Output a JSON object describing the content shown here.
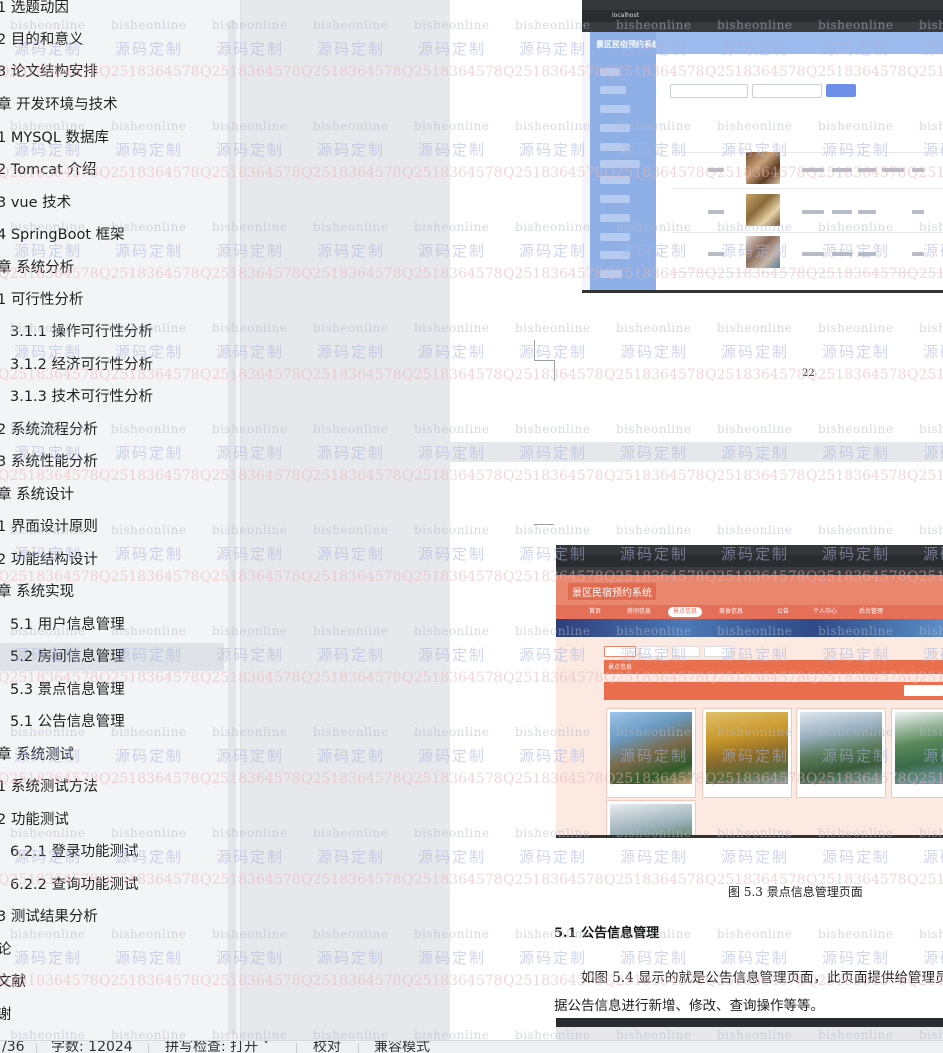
{
  "outline": {
    "items": [
      {
        "label": "1 选题动因",
        "level": 2
      },
      {
        "label": "2 目的和意义",
        "level": 2
      },
      {
        "label": "3 论文结构安排",
        "level": 2
      },
      {
        "label": "章  开发环境与技术",
        "level": 1
      },
      {
        "label": "1 MYSQL 数据库",
        "level": 2
      },
      {
        "label": "2 Tomcat  介绍",
        "level": 2
      },
      {
        "label": "3 vue 技术",
        "level": 2
      },
      {
        "label": "4 SpringBoot 框架",
        "level": 2
      },
      {
        "label": "章  系统分析",
        "level": 1
      },
      {
        "label": "1 可行性分析",
        "level": 2
      },
      {
        "label": "3.1.1 操作可行性分析",
        "level": 3
      },
      {
        "label": "3.1.2 经济可行性分析",
        "level": 3
      },
      {
        "label": "3.1.3 技术可行性分析",
        "level": 3
      },
      {
        "label": "2 系统流程分析",
        "level": 2
      },
      {
        "label": "3 系统性能分析",
        "level": 2
      },
      {
        "label": "章  系统设计",
        "level": 1
      },
      {
        "label": "1 界面设计原则",
        "level": 2
      },
      {
        "label": "2 功能结构设计",
        "level": 2
      },
      {
        "label": "章  系统实现",
        "level": 1
      },
      {
        "label": "5.1 用户信息管理",
        "level": 3
      },
      {
        "label": "5.2  房间信息管理",
        "level": 3,
        "active": true
      },
      {
        "label": "5.3 景点信息管理",
        "level": 3
      },
      {
        "label": "5.1 公告信息管理",
        "level": 3
      },
      {
        "label": "章  系统测试",
        "level": 1
      },
      {
        "label": "1  系统测试方法",
        "level": 2
      },
      {
        "label": "2  功能测试",
        "level": 2
      },
      {
        "label": "6.2.1  登录功能测试",
        "level": 3
      },
      {
        "label": "6.2.2  查询功能测试",
        "level": 3
      },
      {
        "label": "3  测试结果分析",
        "level": 2
      },
      {
        "label": "论",
        "level": 1
      },
      {
        "label": "文献",
        "level": 1
      },
      {
        "label": "谢",
        "level": 1
      }
    ]
  },
  "document": {
    "page_number": "22",
    "figure_caption": "图 5.3  景点信息管理页面",
    "section_heading": "5.1 公告信息管理",
    "para_line1": "如图 5.4 显示的就是公告信息管理页面，此页面提供给管理员",
    "para_line2": "据公告信息进行新增、修改、查询操作等等。"
  },
  "admin_shot": {
    "title": "景区民宿预约系统",
    "url": "localhost"
  },
  "front_shot": {
    "logo": "景区民宿预约系统",
    "nav_tabs": [
      "首页",
      "房间信息",
      "景点信息",
      "美食信息",
      "公告",
      "个人中心",
      "后台管理"
    ],
    "section": "景点信息"
  },
  "watermark": {
    "text_a": "bisheonline",
    "text_b": "源码定制",
    "text_c": "Q2518364578"
  },
  "status_bar": {
    "page": "/36",
    "words": "字数: 12024",
    "spell": "拼写检查: 打开 ˅",
    "proof": "校对",
    "compat": "兼容模式"
  },
  "colors": {
    "admin_accent": "#8fb0e6",
    "front_accent": "#e8866e"
  }
}
